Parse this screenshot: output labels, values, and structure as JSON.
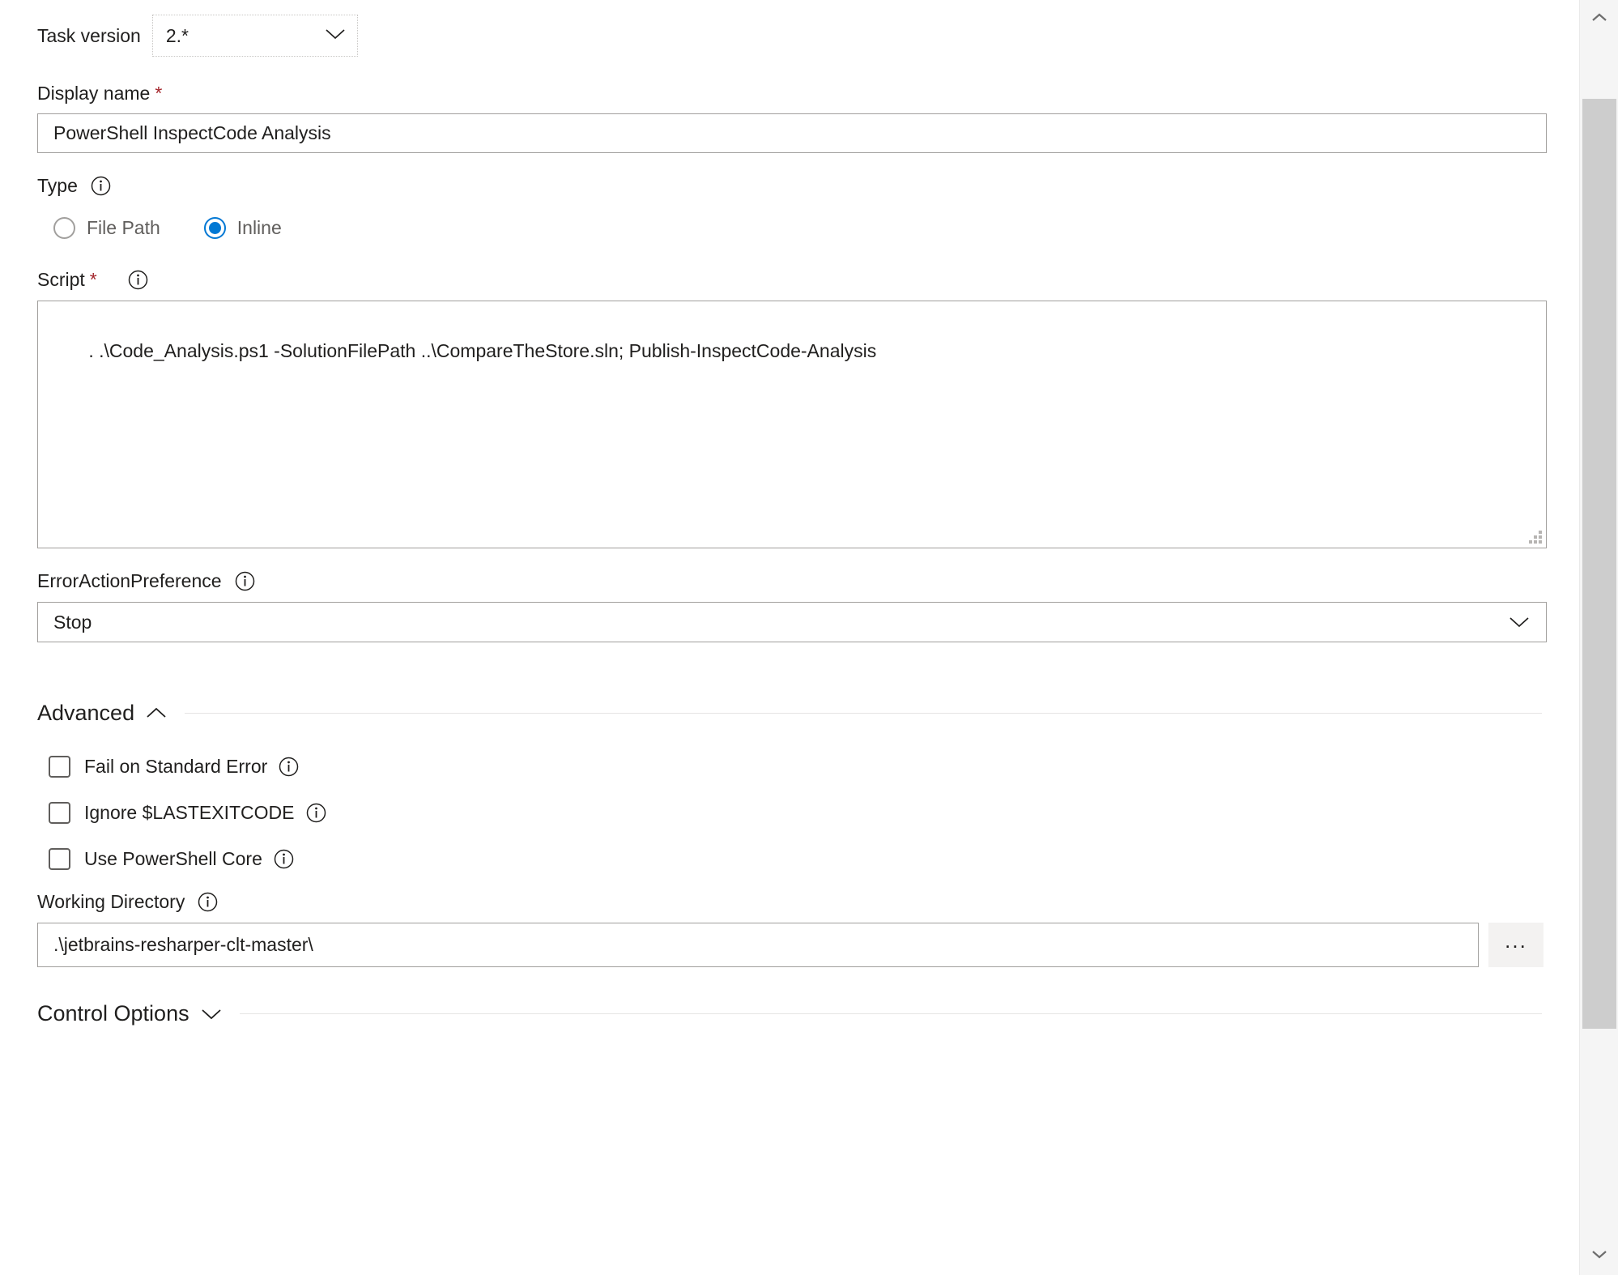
{
  "task_version": {
    "label": "Task version",
    "value": "2.*",
    "chevron": "chevron-down-icon"
  },
  "display_name": {
    "label": "Display name",
    "required_marker": "*",
    "value": "PowerShell InspectCode Analysis"
  },
  "type": {
    "label": "Type",
    "info": "info-icon",
    "options": [
      {
        "label": "File Path",
        "selected": false
      },
      {
        "label": "Inline",
        "selected": true
      }
    ]
  },
  "script": {
    "label": "Script",
    "required_marker": "*",
    "info": "info-icon",
    "value": ". .\\Code_Analysis.ps1 -SolutionFilePath ..\\CompareTheStore.sln; Publish-InspectCode-Analysis"
  },
  "error_action_preference": {
    "label": "ErrorActionPreference",
    "info": "info-icon",
    "value": "Stop",
    "chevron": "chevron-down-icon"
  },
  "advanced": {
    "title": "Advanced",
    "chevron": "chevron-up-icon",
    "expanded": true,
    "checkboxes": [
      {
        "label": "Fail on Standard Error",
        "checked": false,
        "info": "info-icon"
      },
      {
        "label": "Ignore $LASTEXITCODE",
        "checked": false,
        "info": "info-icon"
      },
      {
        "label": "Use PowerShell Core",
        "checked": false,
        "info": "info-icon"
      }
    ],
    "working_directory": {
      "label": "Working Directory",
      "info": "info-icon",
      "value": ".\\jetbrains-resharper-clt-master\\",
      "browse_label": "..."
    }
  },
  "control_options": {
    "title": "Control Options",
    "chevron": "chevron-down-icon",
    "expanded": false
  },
  "scrollbar": {
    "up_icon": "chevron-up-icon",
    "down_icon": "chevron-down-icon"
  },
  "colors": {
    "accent": "#0078d4",
    "required": "#a4262c",
    "border": "#a19f9d",
    "muted_text": "#605e5c",
    "text": "#201f1e"
  }
}
